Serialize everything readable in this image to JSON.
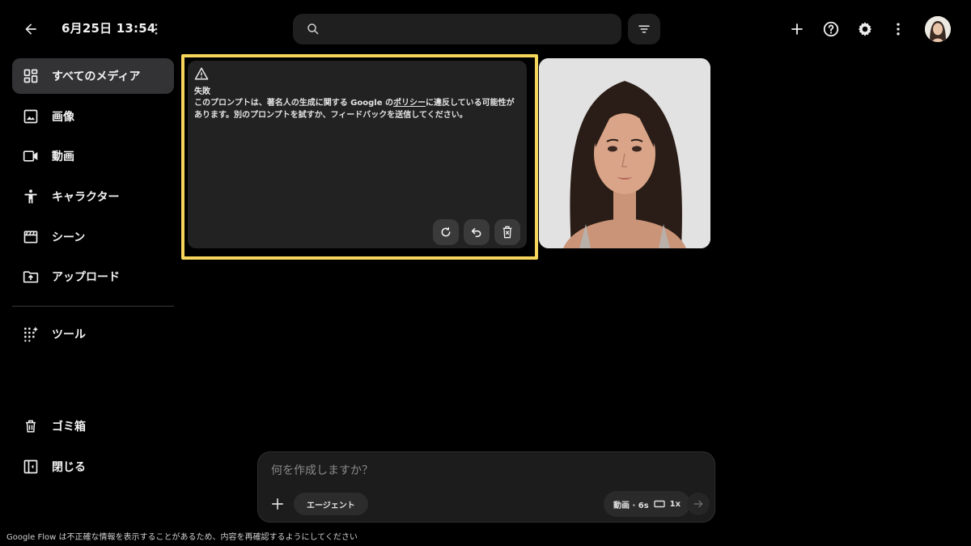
{
  "header": {
    "title": "6月25日 13:54",
    "search_placeholder": ""
  },
  "sidebar": {
    "items": [
      {
        "label": "すべてのメディア",
        "icon": "grid-icon",
        "active": true
      },
      {
        "label": "画像",
        "icon": "image-icon"
      },
      {
        "label": "動画",
        "icon": "video-icon"
      },
      {
        "label": "キャラクター",
        "icon": "person-icon"
      },
      {
        "label": "シーン",
        "icon": "clapperboard-icon"
      },
      {
        "label": "アップロード",
        "icon": "folder-upload-icon"
      }
    ],
    "tools_label": "ツール",
    "trash_label": "ゴミ箱",
    "close_label": "閉じる"
  },
  "error_card": {
    "title": "失敗",
    "message_before": "このプロンプトは、著名人の生成に関する Google の",
    "message_link": "ポリシー",
    "message_after": "に違反している可能性があります。別のプロンプトを試すか、フィードバックを送信してください。",
    "border_color": "#f6d55c"
  },
  "prompt": {
    "placeholder": "何を作成しますか？",
    "agent_label": "エージェント",
    "settings_label": "動画 · 6s",
    "multiplier_label": "1x"
  },
  "footer": {
    "note": "Google Flow は不正確な情報を表示することがあるため、内容を再確認するようにしてください"
  }
}
